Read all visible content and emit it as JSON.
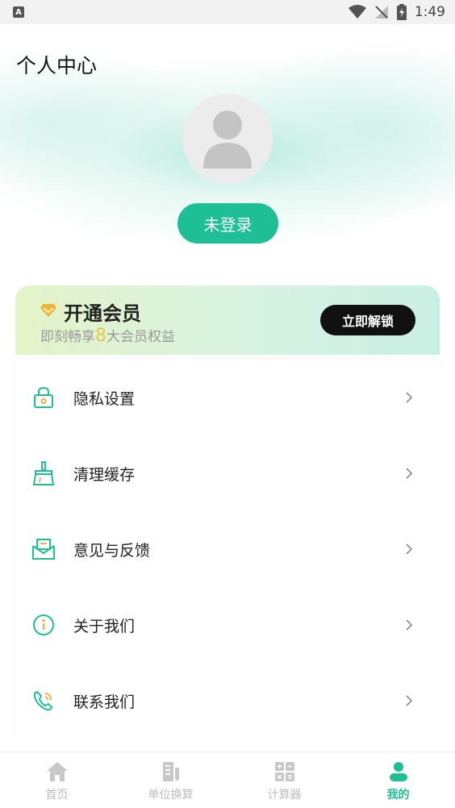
{
  "status_bar": {
    "app_badge": "A",
    "time": "1:49"
  },
  "header": {
    "title": "个人中心",
    "login_label": "未登录"
  },
  "vip": {
    "title": "开通会员",
    "subtitle_prefix": "即刻畅享",
    "subtitle_number": "8",
    "subtitle_suffix": "大会员权益",
    "unlock_label": "立即解锁",
    "highlight_color": "#e8c84a"
  },
  "menu": {
    "items": [
      {
        "label": "隐私设置",
        "icon": "lock-icon"
      },
      {
        "label": "清理缓存",
        "icon": "broom-icon"
      },
      {
        "label": "意见与反馈",
        "icon": "mail-icon"
      },
      {
        "label": "关于我们",
        "icon": "info-icon"
      },
      {
        "label": "联系我们",
        "icon": "phone-icon"
      }
    ]
  },
  "tabs": [
    {
      "label": "首页",
      "icon": "home-icon",
      "active": false
    },
    {
      "label": "单位换算",
      "icon": "ruler-icon",
      "active": false
    },
    {
      "label": "计算器",
      "icon": "calculator-icon",
      "active": false
    },
    {
      "label": "我的",
      "icon": "user-icon",
      "active": true
    }
  ],
  "colors": {
    "accent": "#1fbf96",
    "inactive_tab": "#bdbdbd"
  }
}
